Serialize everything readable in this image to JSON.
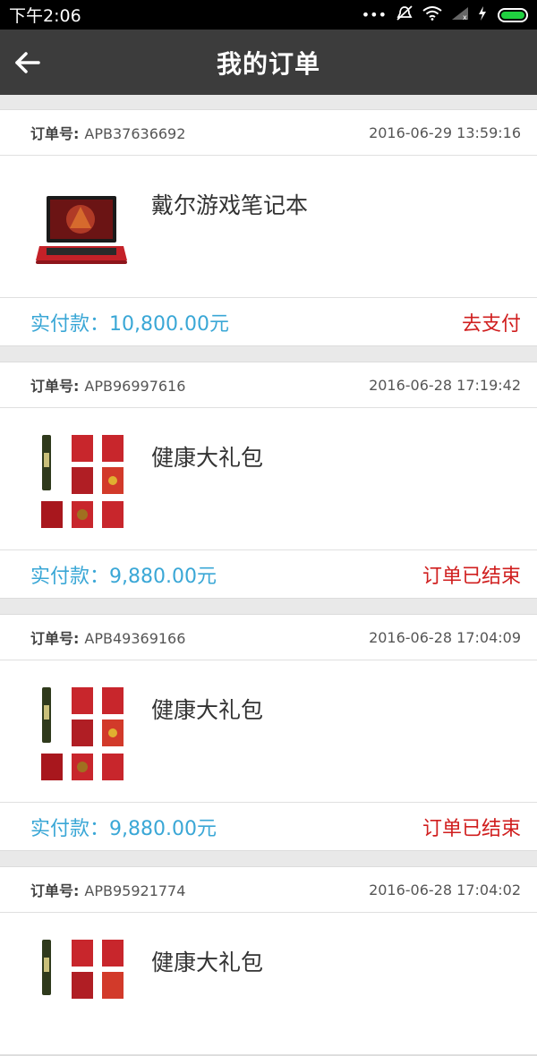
{
  "status": {
    "time": "下午2:06",
    "icons": [
      "more-dots-icon",
      "mute-icon",
      "wifi-icon",
      "signal-icon",
      "charging-icon",
      "battery-icon"
    ],
    "battery_color": "#20d040"
  },
  "header": {
    "back_icon": "back-arrow-icon",
    "title": "我的订单",
    "bg_color": "#3c3c3c"
  },
  "orders": [
    {
      "label": "订单号:",
      "number": "APB37636692",
      "datetime": "2016-06-29 13:59:16",
      "product": "戴尔游戏笔记本",
      "thumbnail": "laptop-image",
      "price": "实付款：10,800.00元",
      "action": "去支付"
    },
    {
      "label": "订单号:",
      "number": "APB96997616",
      "datetime": "2016-06-28 17:19:42",
      "product": "健康大礼包",
      "thumbnail": "gift-pack-image",
      "price": "实付款：9,880.00元",
      "action": "订单已结束"
    },
    {
      "label": "订单号:",
      "number": "APB49369166",
      "datetime": "2016-06-28 17:04:09",
      "product": "健康大礼包",
      "thumbnail": "gift-pack-image",
      "price": "实付款：9,880.00元",
      "action": "订单已结束"
    },
    {
      "label": "订单号:",
      "number": "APB95921774",
      "datetime": "2016-06-28 17:04:02",
      "product": "健康大礼包",
      "thumbnail": "gift-pack-image",
      "price": "",
      "action": ""
    }
  ],
  "colors": {
    "price": "#3aa7d6",
    "action": "#d01e1e"
  }
}
